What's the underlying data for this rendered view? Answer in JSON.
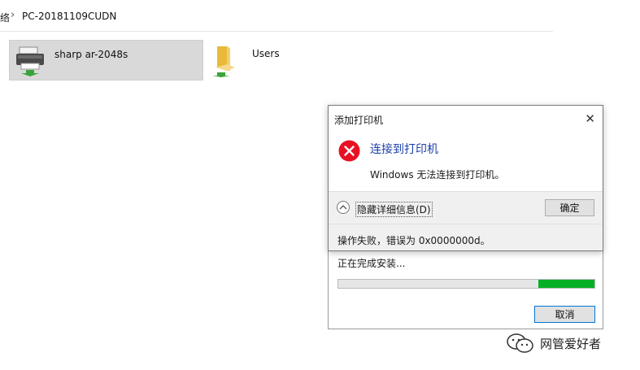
{
  "breadcrumb": {
    "previous": "络",
    "separator": "›",
    "current": "PC-20181109CUDN"
  },
  "items": [
    {
      "label": "sharp ar-2048s",
      "icon": "printer-icon"
    },
    {
      "label": "Users",
      "icon": "folder-icon"
    }
  ],
  "progress_dialog": {
    "status": "正在完成安装...",
    "progress": {
      "segment_start": 0.78,
      "segment_end": 1.0,
      "color": "#06b025"
    },
    "cancel_label": "取消"
  },
  "error_dialog": {
    "title": "添加打印机",
    "close_label": "✕",
    "heading": "连接到打印机",
    "message": "Windows 无法连接到打印机。",
    "toggle_details_label": "隐藏详细信息(D)",
    "ok_label": "确定",
    "details_text": "操作失败，错误为 0x0000000d。",
    "heading_color": "#1c3fa8",
    "error_color": "#e81123"
  },
  "watermark": {
    "text": "网管爱好者"
  }
}
